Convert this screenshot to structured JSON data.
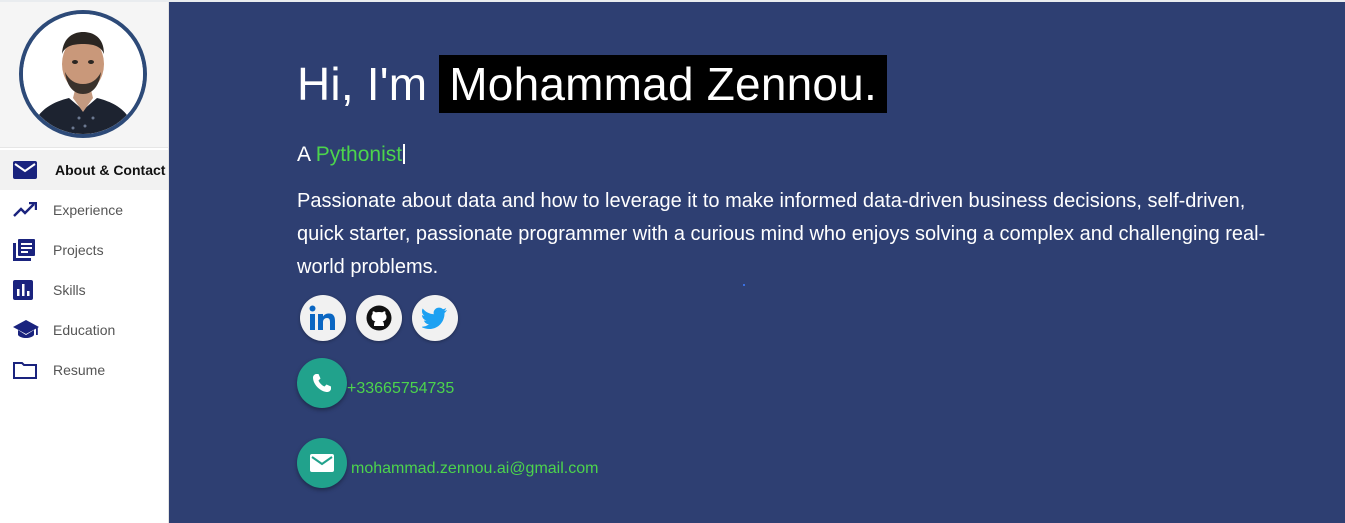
{
  "profile": {
    "avatar_alt": "profile-photo"
  },
  "sidebar": {
    "items": [
      {
        "label": "About & Contact",
        "icon": "envelope-icon",
        "active": true
      },
      {
        "label": "Experience",
        "icon": "trending-up-icon",
        "active": false
      },
      {
        "label": "Projects",
        "icon": "document-stack-icon",
        "active": false
      },
      {
        "label": "Skills",
        "icon": "bar-chart-icon",
        "active": false
      },
      {
        "label": "Education",
        "icon": "graduation-cap-icon",
        "active": false
      },
      {
        "label": "Resume",
        "icon": "folder-icon",
        "active": false
      }
    ]
  },
  "hero": {
    "greeting": "Hi, I'm",
    "name": "Mohammad Zennou.",
    "role_prefix": "A",
    "role_word": "Pythonist",
    "bio": "Passionate about data and how to leverage it to make informed data-driven business decisions, self-driven, quick starter, passionate programmer with a curious mind who enjoys solving a complex and challenging real-world problems."
  },
  "socials": [
    {
      "name": "linkedin",
      "icon": "linkedin-icon"
    },
    {
      "name": "github",
      "icon": "github-icon"
    },
    {
      "name": "twitter",
      "icon": "twitter-icon"
    }
  ],
  "contact": {
    "phone": "+33665754735",
    "email": "mohammad.zennou.ai@gmail.com"
  },
  "colors": {
    "main_bg": "#2e3f72",
    "accent_green": "#4cd44c",
    "contact_bubble": "#21a28c",
    "nav_icon": "#1a237e",
    "avatar_border": "#2d4a78"
  }
}
